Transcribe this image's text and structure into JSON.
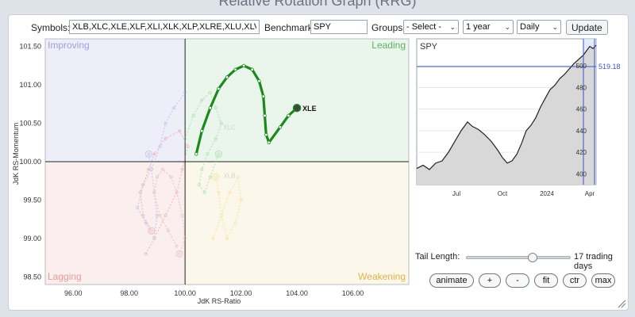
{
  "page_title": "Relative Rotation Graph (RRG)",
  "toolbar": {
    "symbols_label": "Symbols:",
    "symbols_value": "XLB,XLC,XLE,XLF,XLI,XLK,XLP,XLRE,XLU,XLV,XLY",
    "benchmark_label": "Benchmark:",
    "benchmark_value": "SPY",
    "groups_label": "Groups:",
    "groups_value": "- Select -",
    "period_value": "1 year",
    "frequency_value": "Daily",
    "update_label": "Update"
  },
  "rrg": {
    "x_axis_label": "JdK RS-Ratio",
    "y_axis_label": "JdK RS-Momentum",
    "x_ticks": [
      "96.00",
      "98.00",
      "100.00",
      "102.00",
      "104.00",
      "106.00"
    ],
    "y_ticks": [
      "101.50",
      "101.00",
      "100.50",
      "100.00",
      "99.50",
      "99.00",
      "98.50"
    ],
    "quadrants": {
      "improving": "Improving",
      "leading": "Leading",
      "lagging": "Lagging",
      "weakening": "Weakening"
    },
    "quadrant_colors": {
      "improving": "#eeeef9",
      "leading": "#eaf5ec",
      "lagging": "#faeeee",
      "weakening": "#fbf7ea"
    },
    "highlight_symbol": "XLE",
    "highlight_color": "#1a8a1a",
    "faded_labels": [
      "XLC",
      "XLB"
    ]
  },
  "chart_data": {
    "type": "scatter",
    "xlabel": "JdK RS-Ratio",
    "ylabel": "JdK RS-Momentum",
    "xlim": [
      95,
      108
    ],
    "ylim": [
      98.4,
      101.6
    ],
    "series": [
      {
        "name": "XLE",
        "x": [
          100.4,
          100.6,
          100.9,
          101.2,
          101.5,
          101.8,
          102.1,
          102.4,
          102.65,
          102.8,
          102.85,
          102.9,
          103.0,
          103.4,
          103.7,
          104.0
        ],
        "y": [
          100.1,
          100.4,
          100.7,
          100.95,
          101.1,
          101.2,
          101.25,
          101.2,
          101.05,
          100.85,
          100.6,
          100.35,
          100.25,
          100.45,
          100.6,
          100.7
        ]
      }
    ]
  },
  "benchmark_chart": {
    "symbol": "SPY",
    "last_value": "519.18",
    "y_ticks": [
      "500",
      "480",
      "460",
      "440",
      "420",
      "400"
    ],
    "x_ticks": [
      "Jul",
      "Oct",
      "2024",
      "Apr"
    ]
  },
  "controls": {
    "tail_length_label": "Tail Length:",
    "tail_length_value": "17 trading days",
    "tail_length_fraction": 0.63,
    "buttons": [
      "animate",
      "+",
      "-",
      "fit",
      "ctr",
      "max"
    ]
  }
}
